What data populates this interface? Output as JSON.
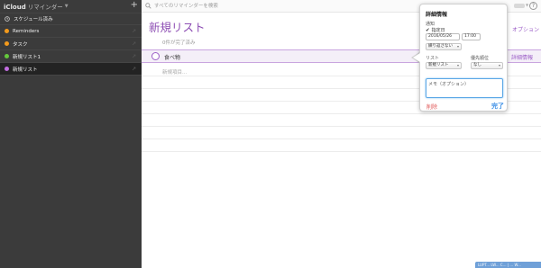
{
  "sidebar": {
    "app_title": "iCloud",
    "app_subtitle": "リマインダー",
    "scheduled_label": "スケジュール済み",
    "items": [
      {
        "label": "Reminders",
        "color": "#f39a1c"
      },
      {
        "label": "タスク",
        "color": "#f39a1c"
      },
      {
        "label": "新規リスト1",
        "color": "#65c83c"
      },
      {
        "label": "新規リスト",
        "color": "#c26de0"
      }
    ]
  },
  "topbar": {
    "search_placeholder": "すべてのリマインダーを検索"
  },
  "main": {
    "list_title": "新規リスト",
    "options_label": "オプション",
    "completed_label": "0件が完了済み",
    "item_text": "食べ物",
    "detail_link": "詳細情報",
    "new_item_placeholder": "新規項目..."
  },
  "popover": {
    "title": "詳細情報",
    "notify_label": "通知",
    "date_checkbox_label": "指定日",
    "date_value": "2016/05/26",
    "time_value": "17:00",
    "repeat_value": "繰り返さない",
    "list_label": "リスト",
    "priority_label": "優先順位",
    "list_value": "新規リスト",
    "priority_value": "なし",
    "note_placeholder": "メモ（オプション）",
    "delete_label": "削除",
    "done_label": "完了"
  },
  "footer": {
    "badge_text": "LUPT... LW... C... | ... W..."
  },
  "colors": {
    "accent": "#9c5fc7",
    "sidebar_bg": "#3b3b3b",
    "done_blue": "#3a8ee6",
    "delete_red": "#e05656"
  }
}
